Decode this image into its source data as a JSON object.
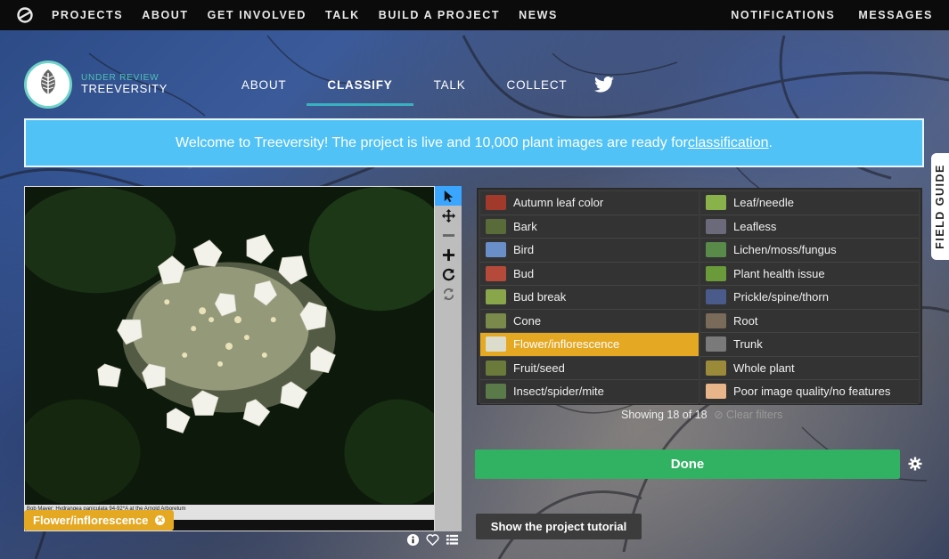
{
  "colors": {
    "topnav_bg": "#0b0b0b",
    "accent_teal": "#39b1c0",
    "banner_bg": "#50c2f6",
    "selected_choice": "#e5a823",
    "done_button": "#31b262",
    "active_tool": "#3aa6ff"
  },
  "topnav": {
    "logo_icon": "zooniverse-logo-icon",
    "left": [
      "PROJECTS",
      "ABOUT",
      "GET INVOLVED",
      "TALK",
      "BUILD A PROJECT",
      "NEWS"
    ],
    "right": [
      "NOTIFICATIONS",
      "MESSAGES"
    ]
  },
  "project": {
    "status": "UNDER REVIEW",
    "name": "TREEVERSITY",
    "tabs": [
      "ABOUT",
      "CLASSIFY",
      "TALK",
      "COLLECT"
    ],
    "active_tab": "CLASSIFY",
    "twitter_icon": "twitter-icon"
  },
  "banner": {
    "text": "Welcome to Treeversity! The project is live and 10,000 plant images are ready for ",
    "link": "classification",
    "suffix": "."
  },
  "field_guide": {
    "label": "FIELD GUIDE"
  },
  "viewer": {
    "caption": "Bob Mayer: Hydrangea paniculata 94-92*A at the Arnold Arboretum",
    "tag": {
      "label": "Flower/inflorescence"
    },
    "tools": [
      "pointer-icon",
      "move-icon",
      "zoom-out-icon",
      "zoom-in-icon",
      "rotate-icon",
      "reset-icon"
    ],
    "meta_icons": [
      "info-icon",
      "heart-icon",
      "list-icon"
    ]
  },
  "choices": {
    "items": [
      {
        "label": "Autumn leaf color",
        "color": "#a23a2c"
      },
      {
        "label": "Bark",
        "color": "#5a6b3a"
      },
      {
        "label": "Bird",
        "color": "#6a8fc8"
      },
      {
        "label": "Bud",
        "color": "#b54a3a"
      },
      {
        "label": "Bud break",
        "color": "#8aa64a"
      },
      {
        "label": "Cone",
        "color": "#7a8a4a"
      },
      {
        "label": "Flower/inflorescence",
        "color": "#dcdccc"
      },
      {
        "label": "Fruit/seed",
        "color": "#6a7a3a"
      },
      {
        "label": "Insect/spider/mite",
        "color": "#5a7a4a"
      },
      {
        "label": "Leaf/needle",
        "color": "#8ab24a"
      },
      {
        "label": "Leafless",
        "color": "#6a6a7a"
      },
      {
        "label": "Lichen/moss/fungus",
        "color": "#5a8a4a"
      },
      {
        "label": "Plant health issue",
        "color": "#6a9a3a"
      },
      {
        "label": "Prickle/spine/thorn",
        "color": "#4a5a8a"
      },
      {
        "label": "Root",
        "color": "#7a6a5a"
      },
      {
        "label": "Trunk",
        "color": "#7a7a7a"
      },
      {
        "label": "Whole plant",
        "color": "#9a8a3a"
      },
      {
        "label": "Poor image quality/no features",
        "color": "#e8b48a"
      }
    ],
    "selected": "Flower/inflorescence",
    "showing": "Showing 18 of 18",
    "clear_filters": "Clear filters"
  },
  "actions": {
    "done": "Done",
    "tutorial": "Show the project tutorial"
  }
}
